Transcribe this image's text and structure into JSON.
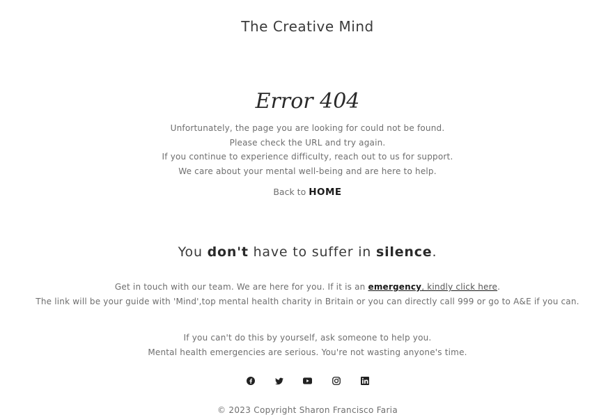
{
  "site": {
    "title": "The Creative Mind"
  },
  "error": {
    "title": "Error 404",
    "lines": [
      "Unfortunately, the page you are looking for could not be found.",
      "Please check the URL and try again.",
      "If you continue to experience difficulty, reach out to us for support.",
      "We care about your mental well-being and are here to help."
    ],
    "back_prefix": "Back to",
    "home_label": "HOME"
  },
  "tagline": {
    "part1": "You",
    "bold1": "don't",
    "part2": "have to suffer in",
    "bold2": "silence",
    "part3": "."
  },
  "contact": {
    "line1_prefix": "Get in touch with our team. We are here for you. If it is an",
    "link_emphasis": "emergency",
    "link_rest": ", kindly click here",
    "line1_suffix": ".",
    "line2": "The link will be your guide with 'Mind',top mental health charity in Britain or you can directly call 999 or go to A&E if you can."
  },
  "help": {
    "line1": "If you can't do this by yourself, ask someone to help you.",
    "line2": "Mental health emergencies are serious. You're not wasting anyone's time."
  },
  "social": [
    "facebook-icon",
    "twitter-icon",
    "youtube-icon",
    "instagram-icon",
    "linkedin-icon"
  ],
  "footer": {
    "copyright": "© 2023 Copyright Sharon Francisco Faria"
  }
}
